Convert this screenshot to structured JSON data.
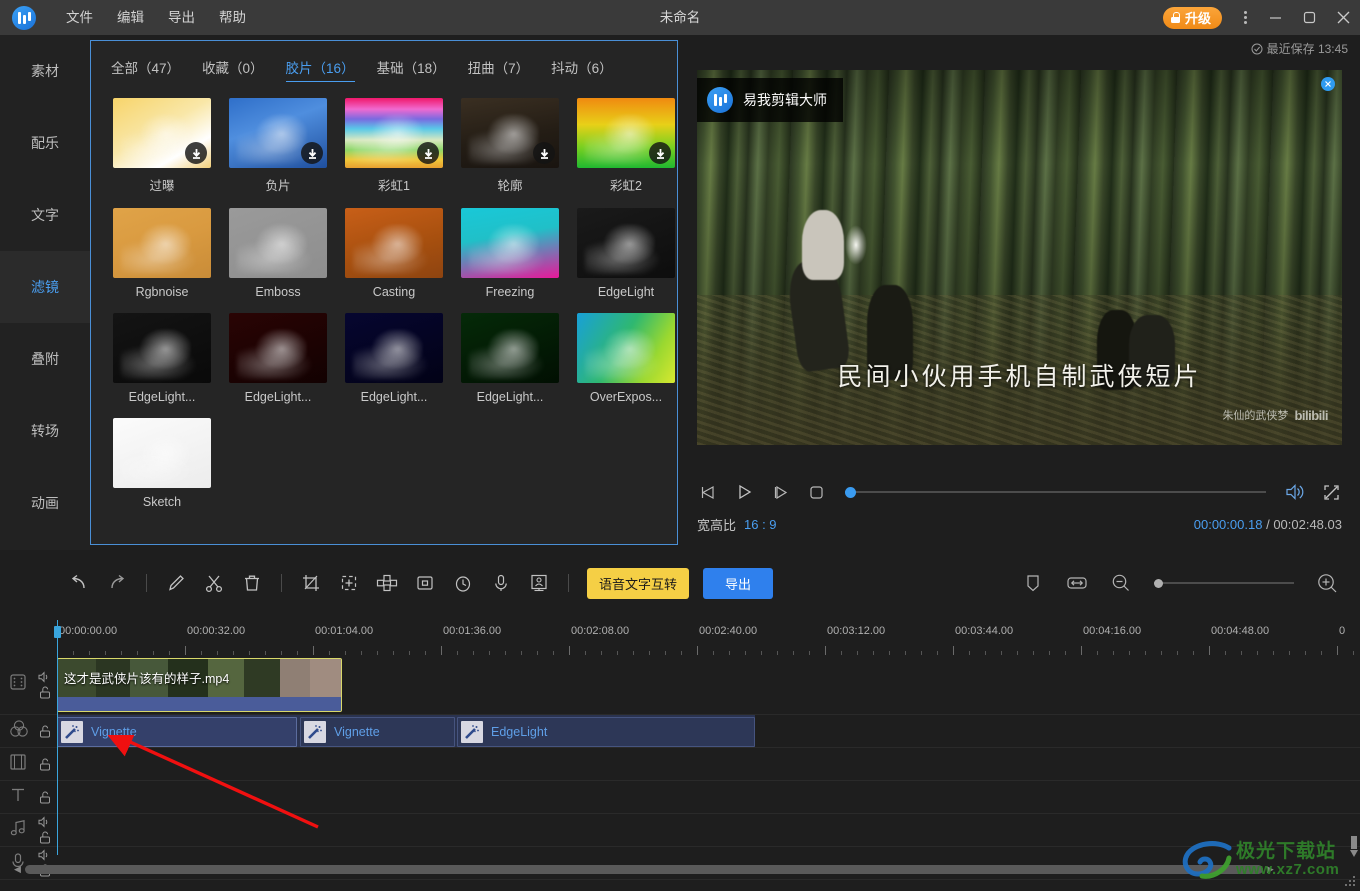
{
  "titlebar": {
    "logo": "app-logo",
    "menus": [
      "文件",
      "编辑",
      "导出",
      "帮助"
    ],
    "doc_title": "未命名",
    "upgrade_label": "升级",
    "more_label": "⋮",
    "minimize_label": "—",
    "maximize_label": "□",
    "close_label": "✕"
  },
  "sidebar": {
    "items": [
      {
        "label": "素材",
        "active": false
      },
      {
        "label": "配乐",
        "active": false
      },
      {
        "label": "文字",
        "active": false
      },
      {
        "label": "滤镜",
        "active": true
      },
      {
        "label": "叠附",
        "active": false
      },
      {
        "label": "转场",
        "active": false
      },
      {
        "label": "动画",
        "active": false
      }
    ]
  },
  "panel": {
    "tabs": [
      {
        "label": "全部（47）",
        "active": false
      },
      {
        "label": "收藏（0）",
        "active": false
      },
      {
        "label": "胶片（16）",
        "active": true
      },
      {
        "label": "基础（18）",
        "active": false
      },
      {
        "label": "扭曲（7）",
        "active": false
      },
      {
        "label": "抖动（6）",
        "active": false
      }
    ],
    "filters": [
      {
        "name": "过曝",
        "download": true,
        "bg": "linear-gradient(150deg,#f7d46a 0%,#f9e7a8 45%,#ffffff 75%,#f2cf7a 100%)"
      },
      {
        "name": "负片",
        "download": true,
        "bg": "linear-gradient(160deg,#2f6fc9 0%,#4f8ede 40%,#1f4f9e 100%)"
      },
      {
        "name": "彩虹1",
        "download": true,
        "bg": "linear-gradient(180deg,#f0186a 0%,#f06ad0 16%,#7a6ae0 30%,#59c9e8 44%,#d8e8c0 60%,#8fd86a 74%,#f0c83a 88%,#e8a030 100%)"
      },
      {
        "name": "轮廓",
        "download": true,
        "bg": "linear-gradient(170deg,#3a2f22 0%,#241d15 55%,#191410 100%)"
      },
      {
        "name": "彩虹2",
        "download": true,
        "bg": "linear-gradient(180deg,#f08a10 0%,#e8d018 38%,#7ad020 70%,#20b830 100%)"
      },
      {
        "name": "Rgbnoise",
        "download": false,
        "bg": "linear-gradient(160deg,#e0a348 0%,#d99a40 50%,#c98c38 100%)"
      },
      {
        "name": "Emboss",
        "download": false,
        "bg": "linear-gradient(160deg,#9a9a9a 0%,#8e8e8e 100%)"
      },
      {
        "name": "Casting",
        "download": false,
        "bg": "linear-gradient(165deg,#c85f18 0%,#a8500f 55%,#8e4410 100%)"
      },
      {
        "name": "Freezing",
        "download": false,
        "bg": "linear-gradient(170deg,#19c8d8 0%,#20c0c8 40%,#e8189a 100%)"
      },
      {
        "name": "EdgeLight",
        "download": false,
        "bg": "linear-gradient(160deg,#1a1a1a,#0d0d0d)"
      },
      {
        "name": "EdgeLight...",
        "download": false,
        "bg": "linear-gradient(160deg,#141414,#090909)"
      },
      {
        "name": "EdgeLight...",
        "download": false,
        "bg": "linear-gradient(160deg,#2a0404,#120101)"
      },
      {
        "name": "EdgeLight...",
        "download": false,
        "bg": "linear-gradient(160deg,#060630,#020216)"
      },
      {
        "name": "EdgeLight...",
        "download": false,
        "bg": "linear-gradient(160deg,#052a08,#010f02)"
      },
      {
        "name": "OverExpos...",
        "download": false,
        "bg": "linear-gradient(120deg,#18a0d8 0%,#2fb870 45%,#9ad830 75%,#d8e830 100%)"
      },
      {
        "name": "Sketch",
        "download": false,
        "bg": "linear-gradient(160deg,#fbfbfb,#ececec)"
      }
    ]
  },
  "preview": {
    "save_status": "最近保存 13:45",
    "brand_overlay": "易我剪辑大师",
    "video_caption": "民间小伙用手机自制武侠短片",
    "video_author": "朱仙的武侠梦",
    "video_platform": "bilibili",
    "ratio_label": "宽高比",
    "ratio_value": "16 : 9",
    "current_time": "00:00:00.18",
    "time_sep": "/",
    "total_time": "00:02:48.03",
    "controls": [
      "prev-frame-button",
      "play-button",
      "next-frame-button",
      "stop-button",
      "volume-button",
      "fullscreen-button"
    ]
  },
  "toolbar": {
    "icons": [
      "undo-icon",
      "redo-icon",
      "edit-pencil-icon",
      "cut-scissors-icon",
      "delete-trash-icon",
      "crop-icon",
      "add-frame-icon",
      "mosaic-icon",
      "pip-icon",
      "speed-clock-icon",
      "microphone-icon",
      "watermark-icon"
    ],
    "voice_text_label": "语音文字互转",
    "export_label": "导出",
    "right_icons": [
      "marker-icon",
      "fit-width-icon",
      "zoom-out-icon",
      "zoom-in-icon"
    ]
  },
  "timeline": {
    "ruler_labels": [
      "00:00:00.00",
      "00:00:32.00",
      "00:01:04.00",
      "00:01:36.00",
      "00:02:08.00",
      "00:02:40.00",
      "00:03:12.00",
      "00:03:44.00",
      "00:04:16.00",
      "00:04:48.00",
      "0"
    ],
    "tracks": [
      {
        "icon": "video-track-icon",
        "has_audio_toggle": true,
        "lock": "unlock-icon"
      },
      {
        "icon": "filter-track-icon",
        "has_audio_toggle": false,
        "lock": "unlock-icon"
      },
      {
        "icon": "overlay-track-icon",
        "has_audio_toggle": false,
        "lock": "unlock-icon"
      },
      {
        "icon": "text-track-icon",
        "has_audio_toggle": false,
        "lock": "unlock-icon"
      },
      {
        "icon": "music-track-icon",
        "has_audio_toggle": true,
        "lock": "unlock-icon"
      },
      {
        "icon": "voiceover-track-icon",
        "has_audio_toggle": true,
        "lock": "unlock-icon"
      }
    ],
    "video_clip": {
      "name": "这才是武侠片该有的样子.mp4"
    },
    "filter_clips": [
      {
        "name": "Vignette",
        "selected": true
      },
      {
        "name": "Vignette",
        "selected": false
      },
      {
        "name": "EdgeLight",
        "selected": false
      }
    ]
  },
  "watermark": {
    "cn": "极光下载站",
    "url": "www.xz7.com"
  },
  "colors": {
    "accent_blue": "#4a9ef0",
    "upgrade_orange": "#f08a16",
    "export_blue": "#2f80ed",
    "voice_yellow": "#f5cf45",
    "clip_selected_border": "#d9d86a",
    "playhead": "#3aa5dd"
  }
}
